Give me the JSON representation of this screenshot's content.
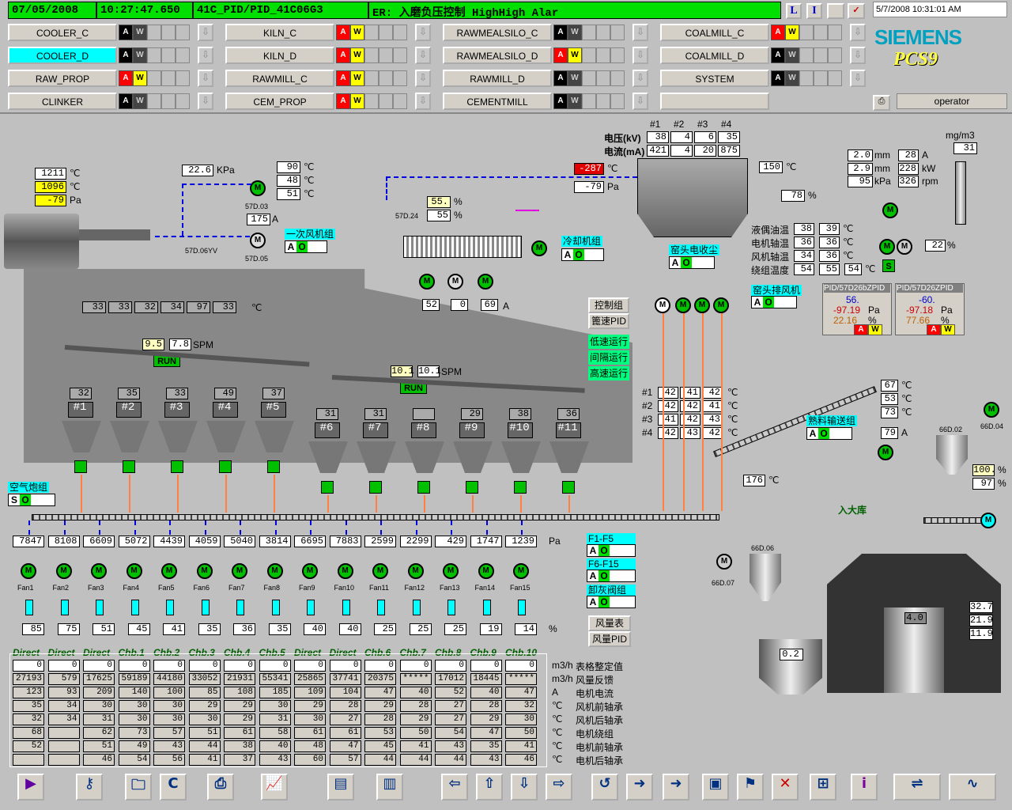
{
  "header": {
    "date": "07/05/2008",
    "time": "10:27:47.650",
    "tag": "41C_PID/PID_41C06G3",
    "alarm": "ER: 入磨负压控制 HighHigh Alar",
    "datetime": "5/7/2008 10:31:01 AM",
    "brand": "SIEMENS",
    "product": "PCS9",
    "user": "operator"
  },
  "areas": [
    {
      "label": "COOLER_C",
      "alarm": false
    },
    {
      "label": "KILN_C",
      "alarm": true
    },
    {
      "label": "RAWMEALSILO_C",
      "alarm": false
    },
    {
      "label": "COALMILL_C",
      "alarm": true
    },
    {
      "label": "COOLER_D",
      "alarm": false,
      "selected": true
    },
    {
      "label": "KILN_D",
      "alarm": true
    },
    {
      "label": "RAWMEALSILO_D",
      "alarm": true
    },
    {
      "label": "COALMILL_D",
      "alarm": false
    },
    {
      "label": "RAW_PROP",
      "alarm": true
    },
    {
      "label": "RAWMILL_C",
      "alarm": true
    },
    {
      "label": "RAWMILL_D",
      "alarm": false
    },
    {
      "label": "SYSTEM",
      "alarm": false
    },
    {
      "label": "CLINKER",
      "alarm": false
    },
    {
      "label": "CEM_PROP",
      "alarm": true
    },
    {
      "label": "CEMENTMILL",
      "alarm": false
    },
    {
      "label": "",
      "alarm": false
    }
  ],
  "kiln_hood": {
    "temp1": "1211",
    "temp2": "1096",
    "press": "-79",
    "unit_c": "℃",
    "unit_pa": "Pa"
  },
  "fan_57d03": {
    "press": "22.6",
    "unit": "KPa",
    "t1": "90",
    "t2": "48",
    "t3": "51",
    "current": "175",
    "tag": "57D.03",
    "tag2": "57D.05",
    "valve": "57D.06YV"
  },
  "primary_fan_group": {
    "label": "一次风机组"
  },
  "cooling_fan_group": {
    "label": "冷却机组"
  },
  "valve_57d24": {
    "tag": "57D.24",
    "v1": "55.",
    "v2": "55",
    "unit": "%"
  },
  "cooler_fans": [
    {
      "amps": "52"
    },
    {
      "amps": "0"
    },
    {
      "amps": "69"
    }
  ],
  "cooler_temps": [
    "33",
    "33",
    "32",
    "34",
    "97",
    "33"
  ],
  "grate1": {
    "speed_sp": "9.5",
    "speed": "7.8",
    "unit": "SPM",
    "state": "RUN"
  },
  "grate2": {
    "speed_sp": "10.1",
    "speed": "10.1",
    "unit": "SPM",
    "state": "RUN"
  },
  "ctrl_buttons": [
    "控制组",
    "篦速PID"
  ],
  "run_buttons": [
    "低速运行",
    "间隔运行",
    "高速运行"
  ],
  "chambers": [
    {
      "id": "#1",
      "t": "32"
    },
    {
      "id": "#2",
      "t": "35"
    },
    {
      "id": "#3",
      "t": "33"
    },
    {
      "id": "#4",
      "t": "49"
    },
    {
      "id": "#5",
      "t": "37"
    },
    {
      "id": "#6",
      "t": "31"
    },
    {
      "id": "#7",
      "t": "31"
    },
    {
      "id": "#8",
      "t": ""
    },
    {
      "id": "#9",
      "t": "29"
    },
    {
      "id": "#10",
      "t": "38"
    },
    {
      "id": "#11",
      "t": "36"
    }
  ],
  "air_cannon": {
    "label": "空气炮组",
    "status": "S"
  },
  "esp": {
    "cols": [
      "#1",
      "#2",
      "#3",
      "#4"
    ],
    "voltage_label": "电压(kV)",
    "voltage": [
      "38",
      "4",
      "6",
      "35"
    ],
    "current_label": "电流(mA)",
    "current": [
      "421",
      "4",
      "20",
      "875"
    ],
    "inlet_temp": "-287",
    "inlet_press": "-79",
    "label": "窑头电收尘"
  },
  "esp_temp": "150",
  "damper_pct": "78",
  "exhaust_fan": {
    "mm1": "2.0",
    "mm2": "2.9",
    "kpa": "95",
    "a": "28",
    "kw": "228",
    "rpm": "326",
    "unit_mm": "mm",
    "unit_a": "A",
    "unit_kw": "kW",
    "unit_kpa": "kPa",
    "unit_rpm": "rpm",
    "dust_unit": "mg/m3",
    "dust": "31",
    "speed_pct": "22",
    "status": "S",
    "label": "窑头排风机"
  },
  "bearings": [
    {
      "label": "液偶油温",
      "v1": "38",
      "v2": "39"
    },
    {
      "label": "电机轴温",
      "v1": "36",
      "v2": "36"
    },
    {
      "label": "风机轴温",
      "v1": "34",
      "v2": "36"
    },
    {
      "label": "绕组温度",
      "v1": "54",
      "v2": "55",
      "v3": "54"
    }
  ],
  "pid_faces": [
    {
      "title": "PID/57D26bZPID",
      "sp": "56.",
      "pv": "-97.19",
      "out": "22.16"
    },
    {
      "title": "PID/57D26ZPID",
      "sp": "-60.",
      "pv": "-97.18",
      "out": "77.66"
    }
  ],
  "esp_hoppers": [
    {
      "id": "#1",
      "v": [
        "42",
        "41",
        "42"
      ]
    },
    {
      "id": "#2",
      "v": [
        "42",
        "42",
        "41"
      ]
    },
    {
      "id": "#3",
      "v": [
        "41",
        "42",
        "43"
      ]
    },
    {
      "id": "#4",
      "v": [
        "42",
        "43",
        "42"
      ]
    }
  ],
  "clinker_conveyor": {
    "label": "熟料输送组",
    "temps": [
      "67",
      "53",
      "73"
    ],
    "amps": "79",
    "temp_in": "176",
    "to_silo": "入大库"
  },
  "silo_66d": {
    "tag1": "66D.02",
    "tag2": "66D.04",
    "v1": "100.",
    "v2": "97",
    "tag3": "66D.06",
    "tag4": "66D.07",
    "small_level": "0.2",
    "big_level": "4.0",
    "readings": [
      "32.7",
      "21.9",
      "11.9"
    ]
  },
  "group_buttons": [
    {
      "label": "F1-F5"
    },
    {
      "label": "F6-F15"
    },
    {
      "label": "卸灰阀组"
    }
  ],
  "flow_buttons": [
    "风量表",
    "风量PID"
  ],
  "fans": [
    {
      "name": "Fan1",
      "pa": "7847",
      "pct": "85",
      "mode": "Direct"
    },
    {
      "name": "Fan2",
      "pa": "8108",
      "pct": "75",
      "mode": "Direct"
    },
    {
      "name": "Fan3",
      "pa": "6609",
      "pct": "51",
      "mode": "Direct"
    },
    {
      "name": "Fan4",
      "pa": "5072",
      "pct": "45",
      "mode": "Chb.1"
    },
    {
      "name": "Fan5",
      "pa": "4439",
      "pct": "41",
      "mode": "Chb.2"
    },
    {
      "name": "Fan6",
      "pa": "4059",
      "pct": "35",
      "mode": "Chb.3"
    },
    {
      "name": "Fan7",
      "pa": "5040",
      "pct": "36",
      "mode": "Chb.4"
    },
    {
      "name": "Fan8",
      "pa": "3814",
      "pct": "35",
      "mode": "Chb.5"
    },
    {
      "name": "Fan9",
      "pa": "6695",
      "pct": "40",
      "mode": "Direct"
    },
    {
      "name": "Fan10",
      "pa": "7883",
      "pct": "40",
      "mode": "Direct"
    },
    {
      "name": "Fan11",
      "pa": "2599",
      "pct": "25",
      "mode": "Chb.6"
    },
    {
      "name": "Fan12",
      "pa": "2299",
      "pct": "25",
      "mode": "Chb.7"
    },
    {
      "name": "Fan13",
      "pa": "429",
      "pct": "25",
      "mode": "Chb.8"
    },
    {
      "name": "Fan14",
      "pa": "1747",
      "pct": "19",
      "mode": "Chb.9"
    },
    {
      "name": "Fan15",
      "pa": "1239",
      "pct": "14",
      "mode": "Chb.10"
    }
  ],
  "fan_table": {
    "labels": [
      {
        "unit": "m3/h",
        "text": "表格整定值"
      },
      {
        "unit": "m3/h",
        "text": "风量反馈"
      },
      {
        "unit": "A",
        "text": "电机电流"
      },
      {
        "unit": "℃",
        "text": "风机前轴承"
      },
      {
        "unit": "℃",
        "text": "风机后轴承"
      },
      {
        "unit": "℃",
        "text": "电机绕组"
      },
      {
        "unit": "℃",
        "text": "电机前轴承"
      },
      {
        "unit": "℃",
        "text": "电机后轴承"
      }
    ],
    "rows": [
      [
        "0",
        "0",
        "0",
        "0",
        "0",
        "0",
        "0",
        "0",
        "0",
        "0",
        "0",
        "0",
        "0",
        "0",
        "0"
      ],
      [
        "27193",
        "579",
        "17625",
        "59189",
        "44180",
        "33052",
        "21931",
        "55341",
        "25865",
        "37741",
        "20375",
        "*****",
        "17012",
        "18445",
        "*****"
      ],
      [
        "123",
        "93",
        "209",
        "140",
        "100",
        "85",
        "108",
        "185",
        "109",
        "104",
        "47",
        "40",
        "52",
        "40",
        "47"
      ],
      [
        "35",
        "34",
        "30",
        "30",
        "30",
        "29",
        "29",
        "30",
        "29",
        "28",
        "29",
        "28",
        "27",
        "28",
        "32"
      ],
      [
        "32",
        "34",
        "31",
        "30",
        "30",
        "30",
        "29",
        "31",
        "30",
        "27",
        "28",
        "29",
        "27",
        "29",
        "30"
      ],
      [
        "68",
        "",
        "62",
        "73",
        "57",
        "51",
        "61",
        "58",
        "61",
        "61",
        "53",
        "50",
        "54",
        "47",
        "50"
      ],
      [
        "52",
        "",
        "51",
        "49",
        "43",
        "44",
        "38",
        "40",
        "48",
        "47",
        "45",
        "41",
        "43",
        "35",
        "41"
      ],
      [
        "",
        "",
        "46",
        "54",
        "56",
        "41",
        "37",
        "43",
        "60",
        "57",
        "44",
        "44",
        "44",
        "43",
        "46"
      ]
    ]
  },
  "units": {
    "c": "℃",
    "pa": "Pa",
    "pct": "%",
    "a": "A"
  },
  "toolbar": [
    "play",
    "key",
    "folder",
    "copy",
    "print",
    "trend",
    "report",
    "report2",
    "left",
    "up",
    "down",
    "right",
    "refresh",
    "next",
    "next2",
    "network",
    "flag",
    "close",
    "ie",
    "info",
    "map",
    "curve"
  ],
  "colors": {
    "bg": "#c0c0c0",
    "status": "#00e000",
    "alarm_red": "#ff0000",
    "alarm_yellow": "#ffff00",
    "cyan": "#00ffff",
    "dash_blue": "#0000e0",
    "magenta": "#e000e0",
    "orange": "#ff8040"
  }
}
